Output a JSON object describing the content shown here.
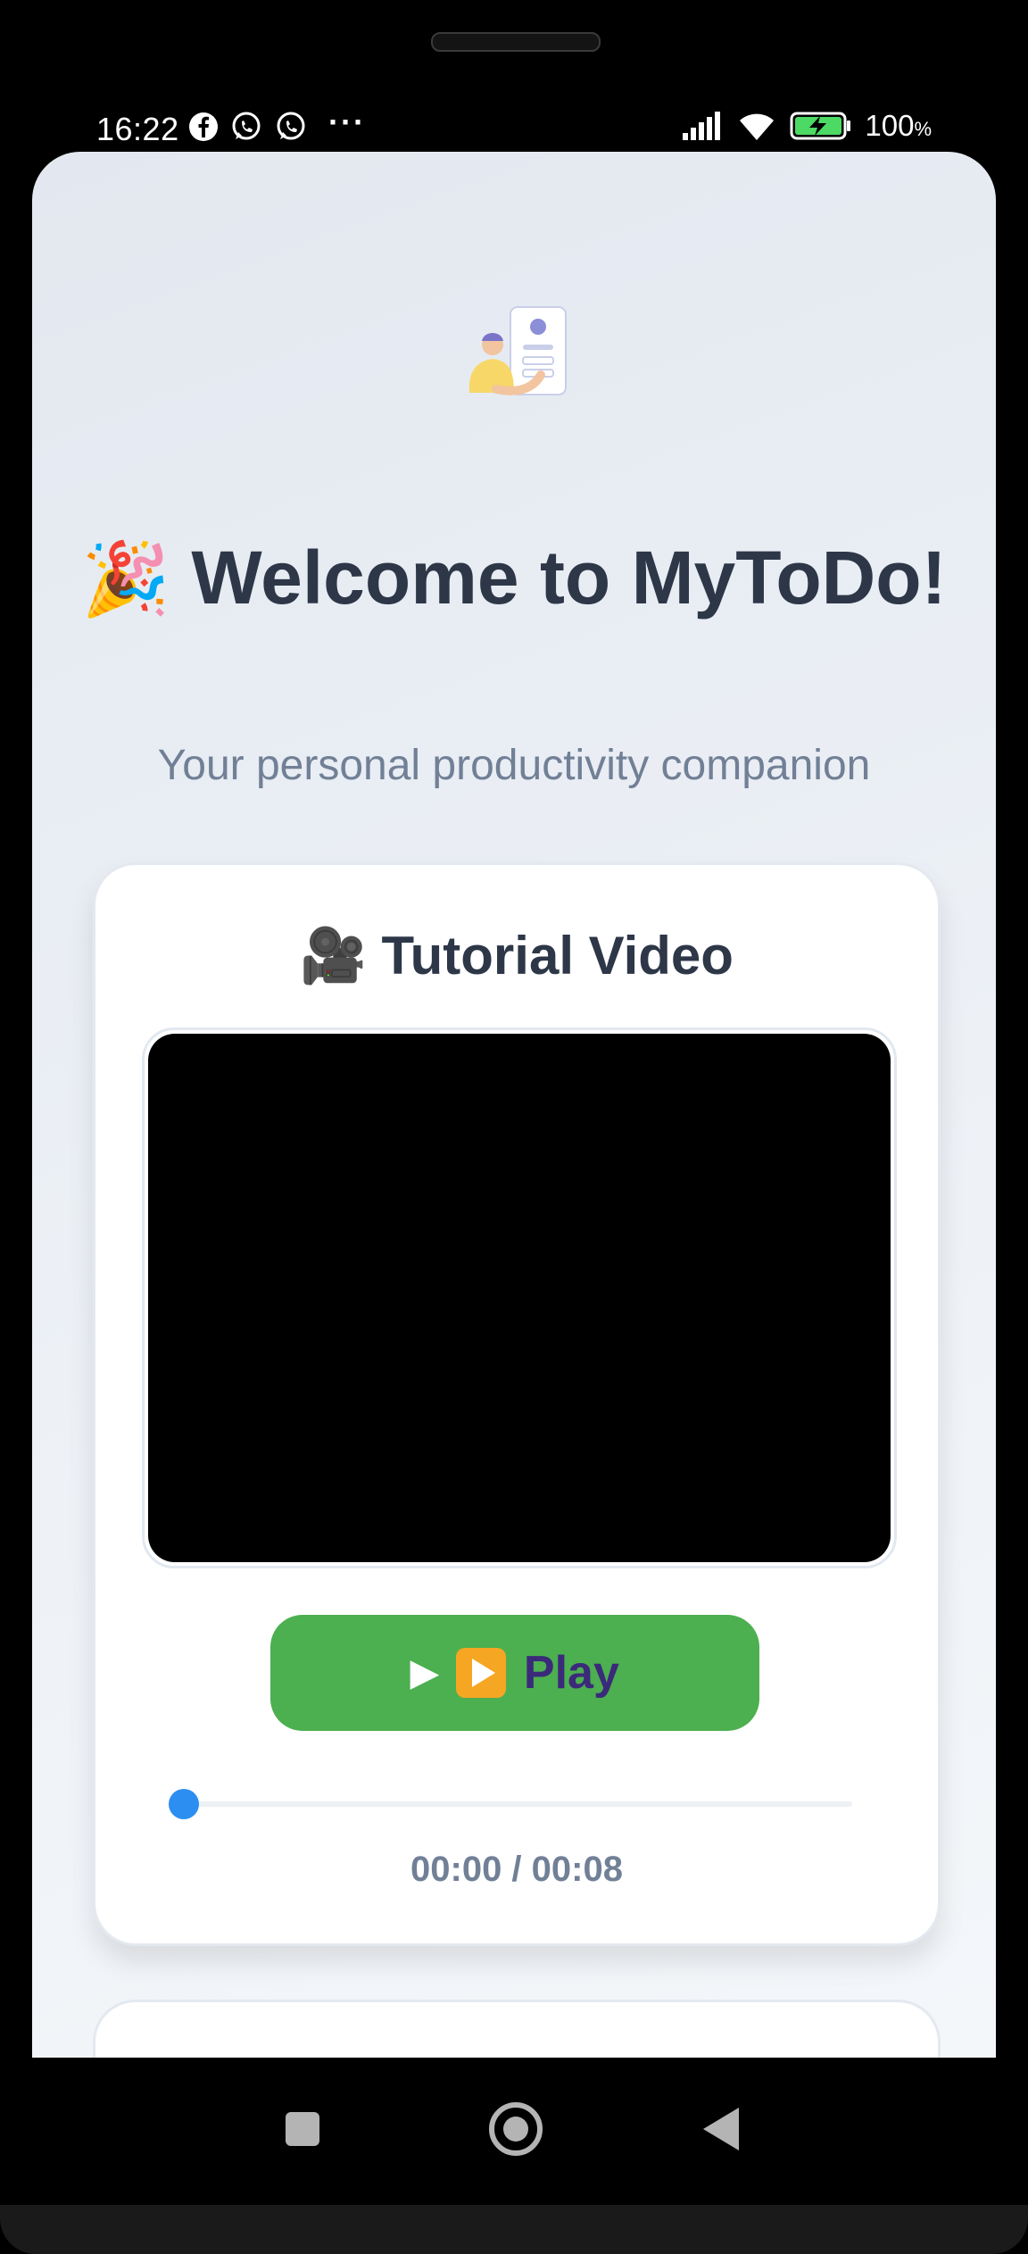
{
  "status_bar": {
    "time": "16:22",
    "notification_icons": [
      "facebook-icon",
      "whatsapp-icon",
      "whatsapp-icon"
    ],
    "overflow": "···",
    "battery_percent": "100",
    "battery_unit": "%"
  },
  "welcome": {
    "emoji": "🎉",
    "title": "Welcome to MyToDo!",
    "subtitle": "Your personal productivity companion"
  },
  "tutorial": {
    "title_emoji": "🎥",
    "title": "Tutorial Video",
    "play_label": "Play",
    "progress": 0,
    "time_readout": "00:00 / 00:08"
  },
  "colors": {
    "play_button": "#4caf50",
    "progress_knob": "#2b8ef0",
    "title_text": "#2d3748",
    "muted_text": "#718096"
  }
}
